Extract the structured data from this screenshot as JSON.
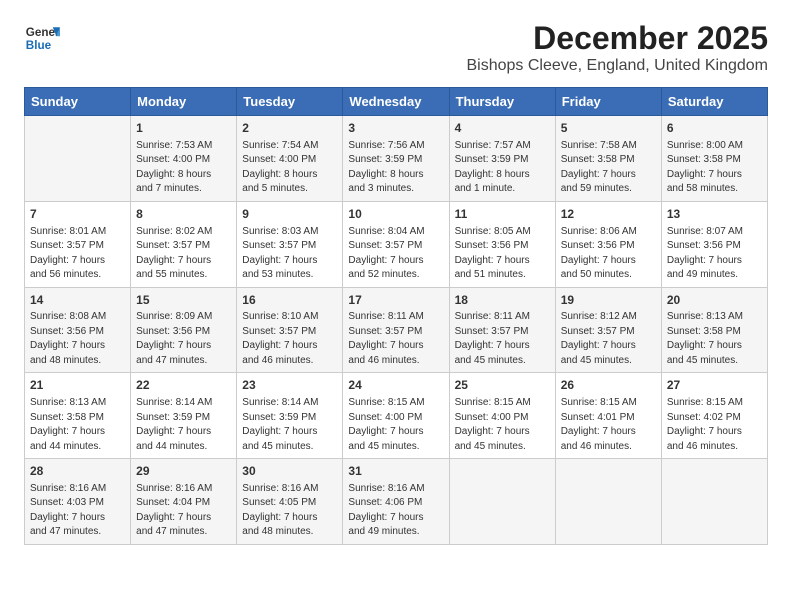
{
  "logo": {
    "general": "General",
    "blue": "Blue"
  },
  "title": "December 2025",
  "subtitle": "Bishops Cleeve, England, United Kingdom",
  "days_of_week": [
    "Sunday",
    "Monday",
    "Tuesday",
    "Wednesday",
    "Thursday",
    "Friday",
    "Saturday"
  ],
  "weeks": [
    [
      {
        "day": "",
        "content": ""
      },
      {
        "day": "1",
        "content": "Sunrise: 7:53 AM\nSunset: 4:00 PM\nDaylight: 8 hours\nand 7 minutes."
      },
      {
        "day": "2",
        "content": "Sunrise: 7:54 AM\nSunset: 4:00 PM\nDaylight: 8 hours\nand 5 minutes."
      },
      {
        "day": "3",
        "content": "Sunrise: 7:56 AM\nSunset: 3:59 PM\nDaylight: 8 hours\nand 3 minutes."
      },
      {
        "day": "4",
        "content": "Sunrise: 7:57 AM\nSunset: 3:59 PM\nDaylight: 8 hours\nand 1 minute."
      },
      {
        "day": "5",
        "content": "Sunrise: 7:58 AM\nSunset: 3:58 PM\nDaylight: 7 hours\nand 59 minutes."
      },
      {
        "day": "6",
        "content": "Sunrise: 8:00 AM\nSunset: 3:58 PM\nDaylight: 7 hours\nand 58 minutes."
      }
    ],
    [
      {
        "day": "7",
        "content": "Sunrise: 8:01 AM\nSunset: 3:57 PM\nDaylight: 7 hours\nand 56 minutes."
      },
      {
        "day": "8",
        "content": "Sunrise: 8:02 AM\nSunset: 3:57 PM\nDaylight: 7 hours\nand 55 minutes."
      },
      {
        "day": "9",
        "content": "Sunrise: 8:03 AM\nSunset: 3:57 PM\nDaylight: 7 hours\nand 53 minutes."
      },
      {
        "day": "10",
        "content": "Sunrise: 8:04 AM\nSunset: 3:57 PM\nDaylight: 7 hours\nand 52 minutes."
      },
      {
        "day": "11",
        "content": "Sunrise: 8:05 AM\nSunset: 3:56 PM\nDaylight: 7 hours\nand 51 minutes."
      },
      {
        "day": "12",
        "content": "Sunrise: 8:06 AM\nSunset: 3:56 PM\nDaylight: 7 hours\nand 50 minutes."
      },
      {
        "day": "13",
        "content": "Sunrise: 8:07 AM\nSunset: 3:56 PM\nDaylight: 7 hours\nand 49 minutes."
      }
    ],
    [
      {
        "day": "14",
        "content": "Sunrise: 8:08 AM\nSunset: 3:56 PM\nDaylight: 7 hours\nand 48 minutes."
      },
      {
        "day": "15",
        "content": "Sunrise: 8:09 AM\nSunset: 3:56 PM\nDaylight: 7 hours\nand 47 minutes."
      },
      {
        "day": "16",
        "content": "Sunrise: 8:10 AM\nSunset: 3:57 PM\nDaylight: 7 hours\nand 46 minutes."
      },
      {
        "day": "17",
        "content": "Sunrise: 8:11 AM\nSunset: 3:57 PM\nDaylight: 7 hours\nand 46 minutes."
      },
      {
        "day": "18",
        "content": "Sunrise: 8:11 AM\nSunset: 3:57 PM\nDaylight: 7 hours\nand 45 minutes."
      },
      {
        "day": "19",
        "content": "Sunrise: 8:12 AM\nSunset: 3:57 PM\nDaylight: 7 hours\nand 45 minutes."
      },
      {
        "day": "20",
        "content": "Sunrise: 8:13 AM\nSunset: 3:58 PM\nDaylight: 7 hours\nand 45 minutes."
      }
    ],
    [
      {
        "day": "21",
        "content": "Sunrise: 8:13 AM\nSunset: 3:58 PM\nDaylight: 7 hours\nand 44 minutes."
      },
      {
        "day": "22",
        "content": "Sunrise: 8:14 AM\nSunset: 3:59 PM\nDaylight: 7 hours\nand 44 minutes."
      },
      {
        "day": "23",
        "content": "Sunrise: 8:14 AM\nSunset: 3:59 PM\nDaylight: 7 hours\nand 45 minutes."
      },
      {
        "day": "24",
        "content": "Sunrise: 8:15 AM\nSunset: 4:00 PM\nDaylight: 7 hours\nand 45 minutes."
      },
      {
        "day": "25",
        "content": "Sunrise: 8:15 AM\nSunset: 4:00 PM\nDaylight: 7 hours\nand 45 minutes."
      },
      {
        "day": "26",
        "content": "Sunrise: 8:15 AM\nSunset: 4:01 PM\nDaylight: 7 hours\nand 46 minutes."
      },
      {
        "day": "27",
        "content": "Sunrise: 8:15 AM\nSunset: 4:02 PM\nDaylight: 7 hours\nand 46 minutes."
      }
    ],
    [
      {
        "day": "28",
        "content": "Sunrise: 8:16 AM\nSunset: 4:03 PM\nDaylight: 7 hours\nand 47 minutes."
      },
      {
        "day": "29",
        "content": "Sunrise: 8:16 AM\nSunset: 4:04 PM\nDaylight: 7 hours\nand 47 minutes."
      },
      {
        "day": "30",
        "content": "Sunrise: 8:16 AM\nSunset: 4:05 PM\nDaylight: 7 hours\nand 48 minutes."
      },
      {
        "day": "31",
        "content": "Sunrise: 8:16 AM\nSunset: 4:06 PM\nDaylight: 7 hours\nand 49 minutes."
      },
      {
        "day": "",
        "content": ""
      },
      {
        "day": "",
        "content": ""
      },
      {
        "day": "",
        "content": ""
      }
    ]
  ]
}
